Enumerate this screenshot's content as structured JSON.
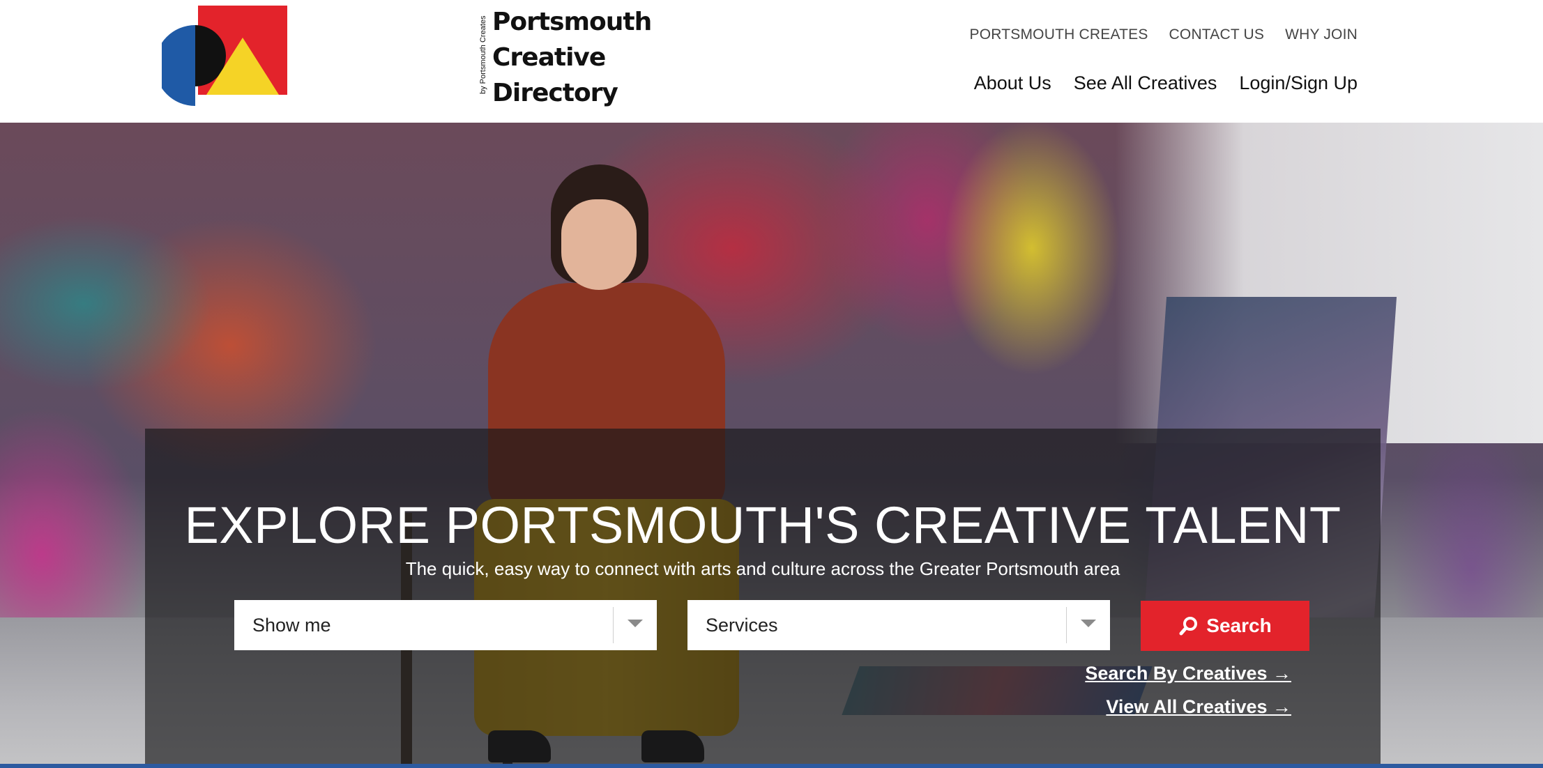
{
  "brand": {
    "name_lines": [
      "Portsmouth",
      "Creative",
      "Directory"
    ],
    "byline": "by Portsmouth Creates",
    "colors": {
      "red": "#e3232b",
      "blue": "#1f5aa6",
      "yellow": "#f5d326",
      "black": "#111111"
    }
  },
  "utility_nav": {
    "items": [
      {
        "label": "PORTSMOUTH CREATES"
      },
      {
        "label": "CONTACT US"
      },
      {
        "label": "WHY JOIN"
      }
    ]
  },
  "main_nav": {
    "items": [
      {
        "label": "About Us"
      },
      {
        "label": "See All Creatives"
      },
      {
        "label": "Login/Sign Up"
      }
    ]
  },
  "hero": {
    "title": "EXPLORE PORTSMOUTH'S CREATIVE TALENT",
    "subtitle": "The quick, easy way to connect with arts and culture across the Greater Portsmouth area",
    "background_image": "artist-with-paintings-photo",
    "filters": {
      "show_me": {
        "value": "Show me",
        "icon": "chevron-down-icon"
      },
      "services": {
        "value": "Services",
        "icon": "chevron-down-icon"
      }
    },
    "search_button": {
      "label": "Search",
      "icon": "search-icon",
      "color": "#e3232b"
    },
    "links": {
      "search_by_creatives": "Search By Creatives →",
      "view_all_creatives": "View All Creatives →"
    }
  }
}
